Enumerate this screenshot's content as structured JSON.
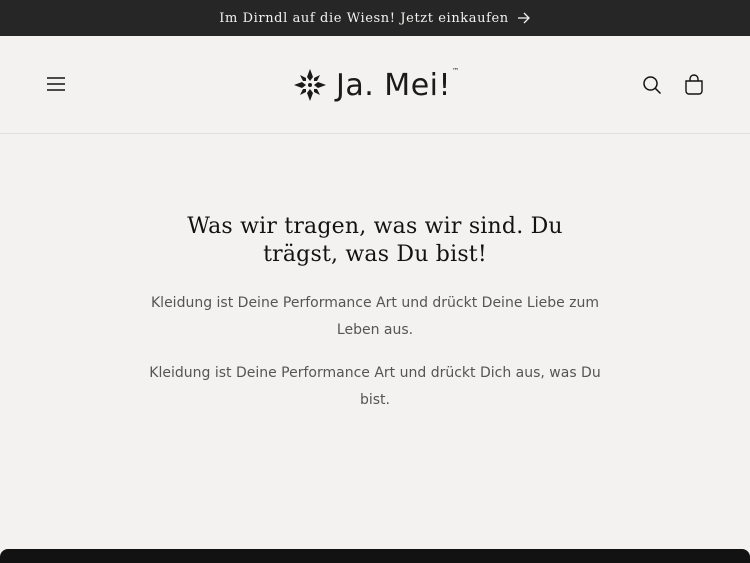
{
  "announcement": {
    "text": "Im Dirndl auf die Wiesn! Jetzt einkaufen",
    "arrow_icon": "arrow-right-icon"
  },
  "header": {
    "menu_icon": "hamburger-menu-icon",
    "logo_text": "Ja. Mei!",
    "logo_tm": "™",
    "search_icon": "search-icon",
    "cart_icon": "cart-icon"
  },
  "main": {
    "headline": "Was wir tragen, was wir sind. Du trägst, was Du bist!",
    "paragraphs": [
      "Kleidung ist Deine Performance Art und drückt Deine Liebe zum Leben aus.",
      "Kleidung ist Deine Performance Art und drückt Dich aus, was Du bist."
    ]
  },
  "colors": {
    "announcement_bg": "#262626",
    "page_bg": "#f3f2f0",
    "text_dark": "#121212",
    "text_body": "#555555"
  }
}
